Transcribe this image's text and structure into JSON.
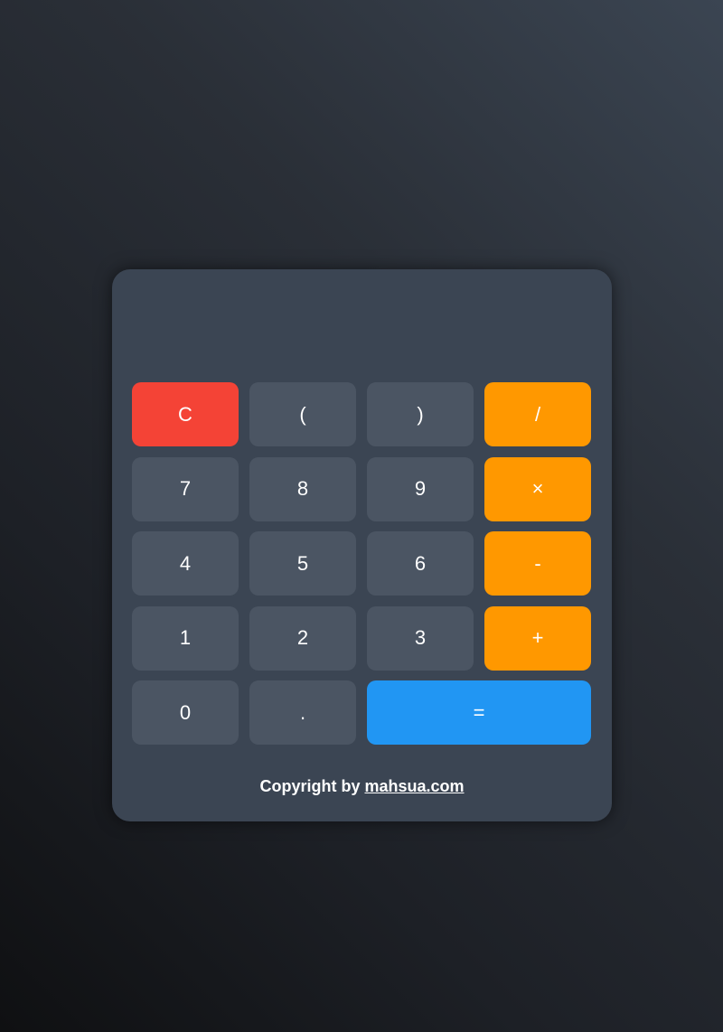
{
  "display": {
    "value": ""
  },
  "keys": {
    "clear": "C",
    "open_paren": "(",
    "close_paren": ")",
    "divide": "/",
    "seven": "7",
    "eight": "8",
    "nine": "9",
    "multiply": "×",
    "four": "4",
    "five": "5",
    "six": "6",
    "subtract": "-",
    "one": "1",
    "two": "2",
    "three": "3",
    "add": "+",
    "zero": "0",
    "decimal": ".",
    "equals": "="
  },
  "footer": {
    "prefix": "Copyright by ",
    "link_text": "mahsua.com"
  },
  "colors": {
    "clear": "#f44336",
    "operator": "#ff9800",
    "equals": "#2196f3",
    "key": "#4b5563",
    "panel": "#3b4553"
  }
}
